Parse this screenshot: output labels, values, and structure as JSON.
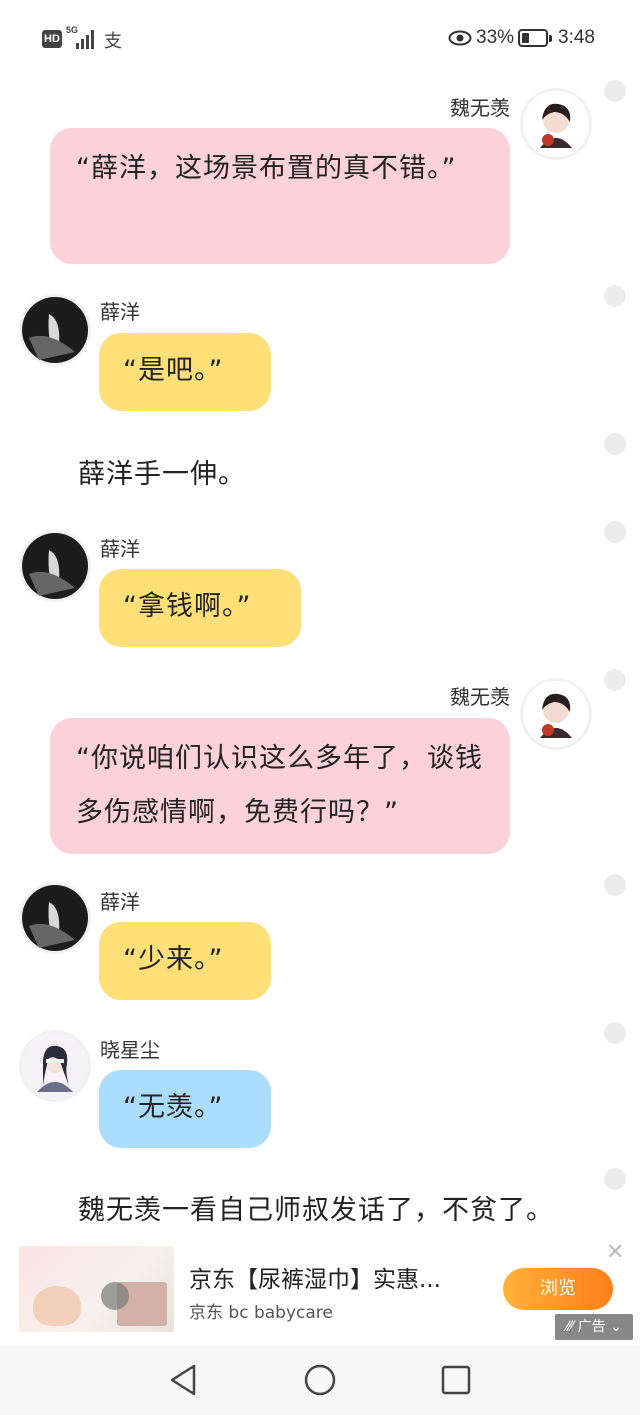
{
  "status_bar": {
    "hd": "HD",
    "network": "5G",
    "battery_percent": "33%",
    "battery_level": 0.33,
    "time": "3:48"
  },
  "messages": [
    {
      "type": "bubble",
      "side": "right",
      "name": "魏无羡",
      "text": "“薛洋，这场景布置的真不错。”",
      "color": "pink"
    },
    {
      "type": "bubble",
      "side": "left",
      "name": "薛洋",
      "text": "“是吧。”",
      "color": "yellow"
    },
    {
      "type": "narration",
      "text": "薛洋手一伸。"
    },
    {
      "type": "bubble",
      "side": "left",
      "name": "薛洋",
      "text": "“拿钱啊。”",
      "color": "yellow"
    },
    {
      "type": "bubble",
      "side": "right",
      "name": "魏无羡",
      "text": "“你说咱们认识这么多年了，谈钱多伤感情啊，免费行吗？”",
      "color": "pink"
    },
    {
      "type": "bubble",
      "side": "left",
      "name": "薛洋",
      "text": "“少来。”",
      "color": "yellow"
    },
    {
      "type": "bubble",
      "side": "left",
      "name": "晓星尘",
      "text": "“无羡。”",
      "color": "blue"
    },
    {
      "type": "narration",
      "text": "魏无羡一看自己师叔发话了，不贫了。"
    }
  ],
  "ad": {
    "title": "京东【尿裤湿巾】实惠...",
    "subtitle": "京东 bc babycare",
    "button": "浏览",
    "tag": "广告",
    "close_icon": "close-icon"
  },
  "colors": {
    "pink": "#fdd1dc",
    "yellow": "#fedf78",
    "blue": "#a9ddfb",
    "ad_button": "#ff9a2a"
  }
}
